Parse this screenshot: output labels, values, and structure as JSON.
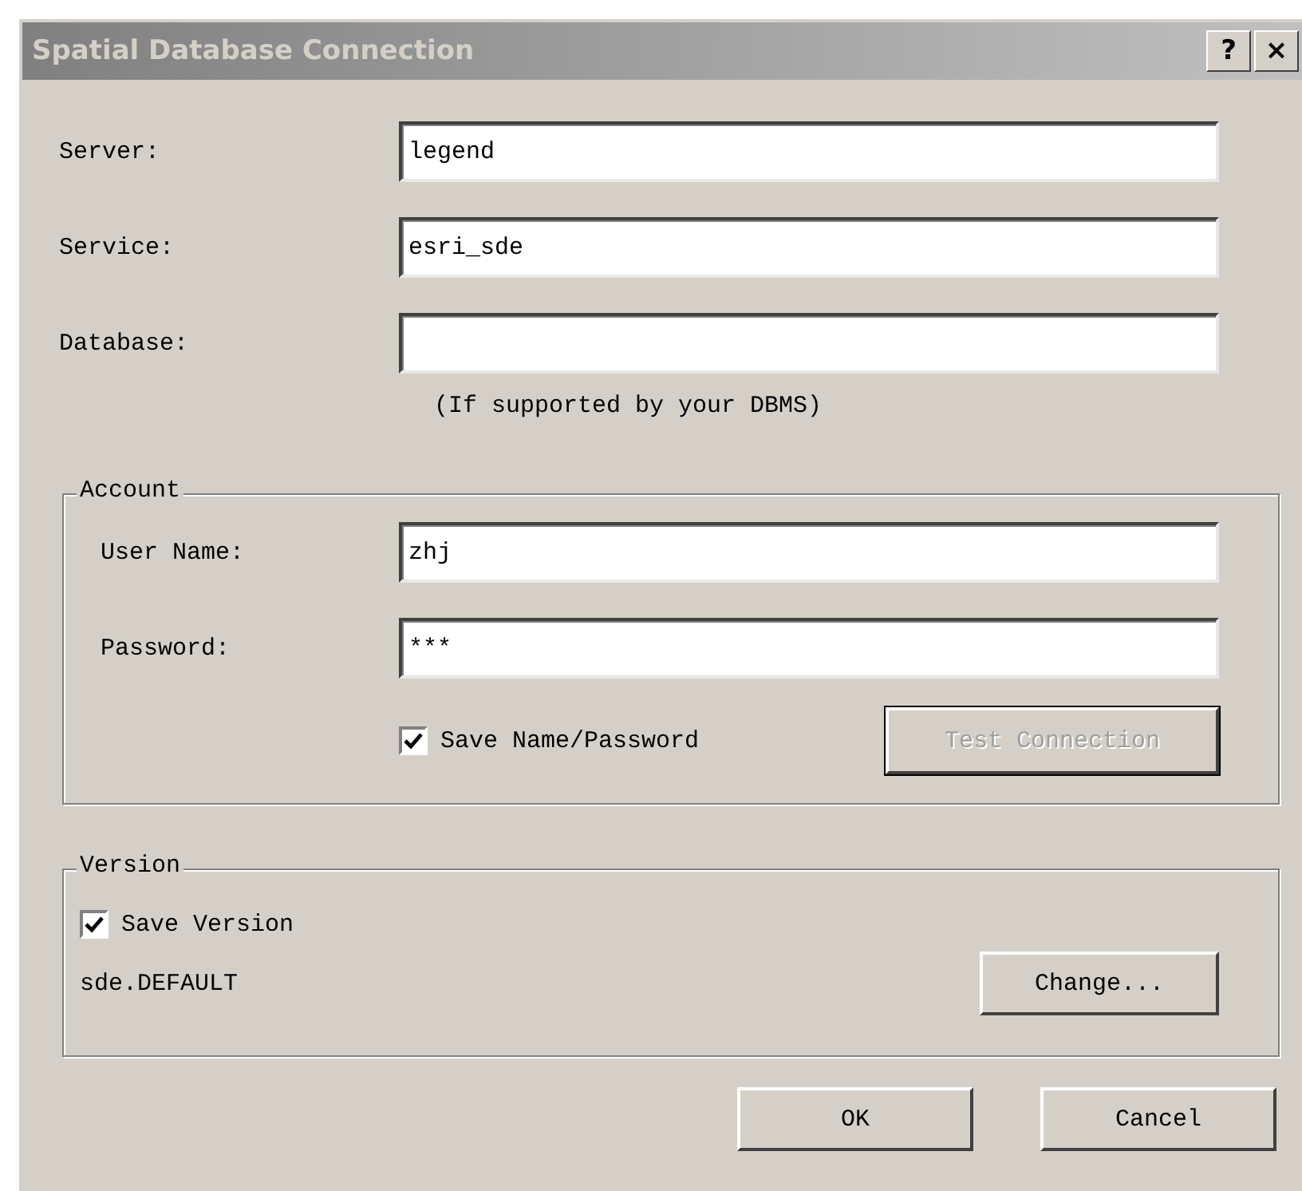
{
  "window": {
    "title": "Spatial Database Connection",
    "title_buttons": [
      "?",
      "×"
    ]
  },
  "fields": [
    {
      "label": "Server:",
      "value": "legend"
    },
    {
      "label": "Service:",
      "value": "esri_sde"
    },
    {
      "label": "Database:",
      "note": "(If supported by your DBMS)"
    }
  ],
  "account": {
    "title": "Account",
    "fields": [
      {
        "label": "User Name:",
        "value": "zhj"
      },
      {
        "label": "Password:",
        "value": "***"
      }
    ],
    "save_checkbox": {
      "label": "Save Name/Password",
      "checked": true
    },
    "test_button": {
      "label": "Test Connection",
      "disabled": true
    }
  },
  "version": {
    "title": "Version",
    "save_checkbox": {
      "label": "Save Version",
      "checked": true
    },
    "current": "sde.DEFAULT",
    "change_button": {
      "label": "Change..."
    }
  },
  "buttons": [
    {
      "label": "OK"
    },
    {
      "label": "Cancel"
    }
  ]
}
